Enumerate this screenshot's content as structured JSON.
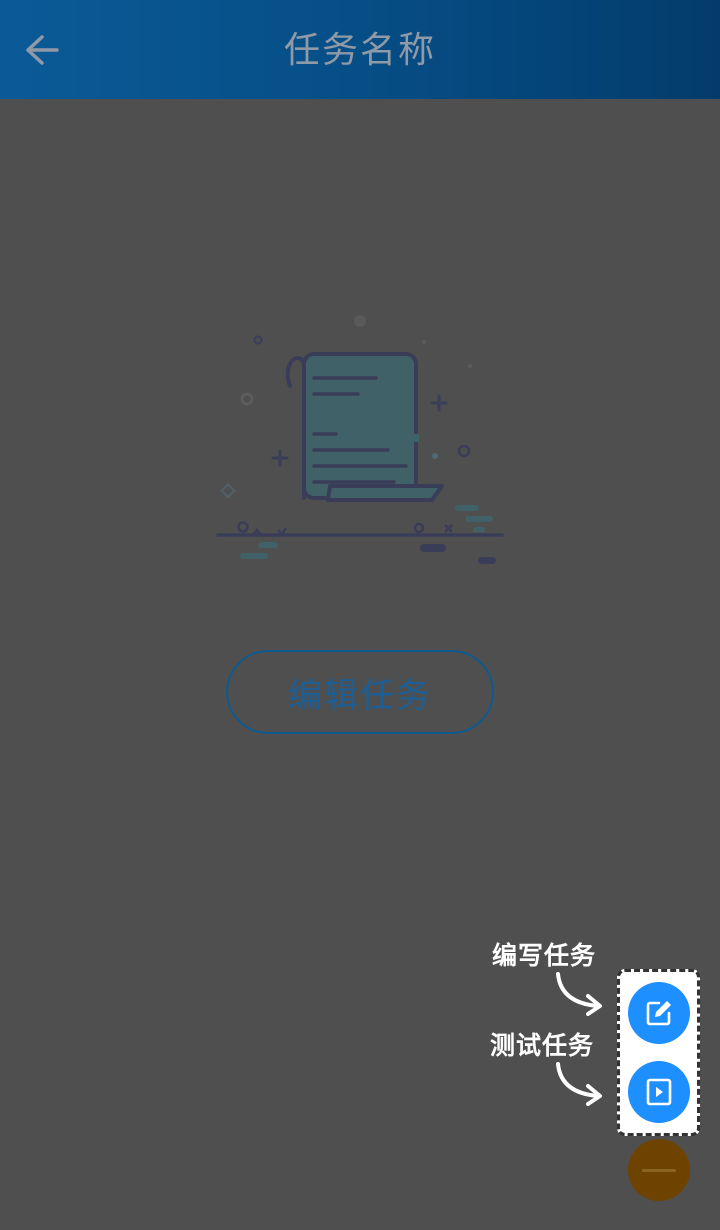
{
  "header": {
    "title": "任务名称",
    "back_icon": "arrow-left-icon"
  },
  "main": {
    "illustration": "empty-task-scroll-illustration",
    "edit_task_label": "编辑任务"
  },
  "guide": {
    "write_hint": "编写任务",
    "test_hint": "测试任务"
  },
  "fab": {
    "write_icon": "edit-icon",
    "test_icon": "play-icon",
    "menu_icon": "collapse-icon"
  },
  "colors": {
    "overlay_bg": "#4f4f4f",
    "header_start": "#0b5a97",
    "header_end": "#033c6c",
    "fab_blue": "#1e8fff",
    "fab_main": "#6e4300"
  }
}
